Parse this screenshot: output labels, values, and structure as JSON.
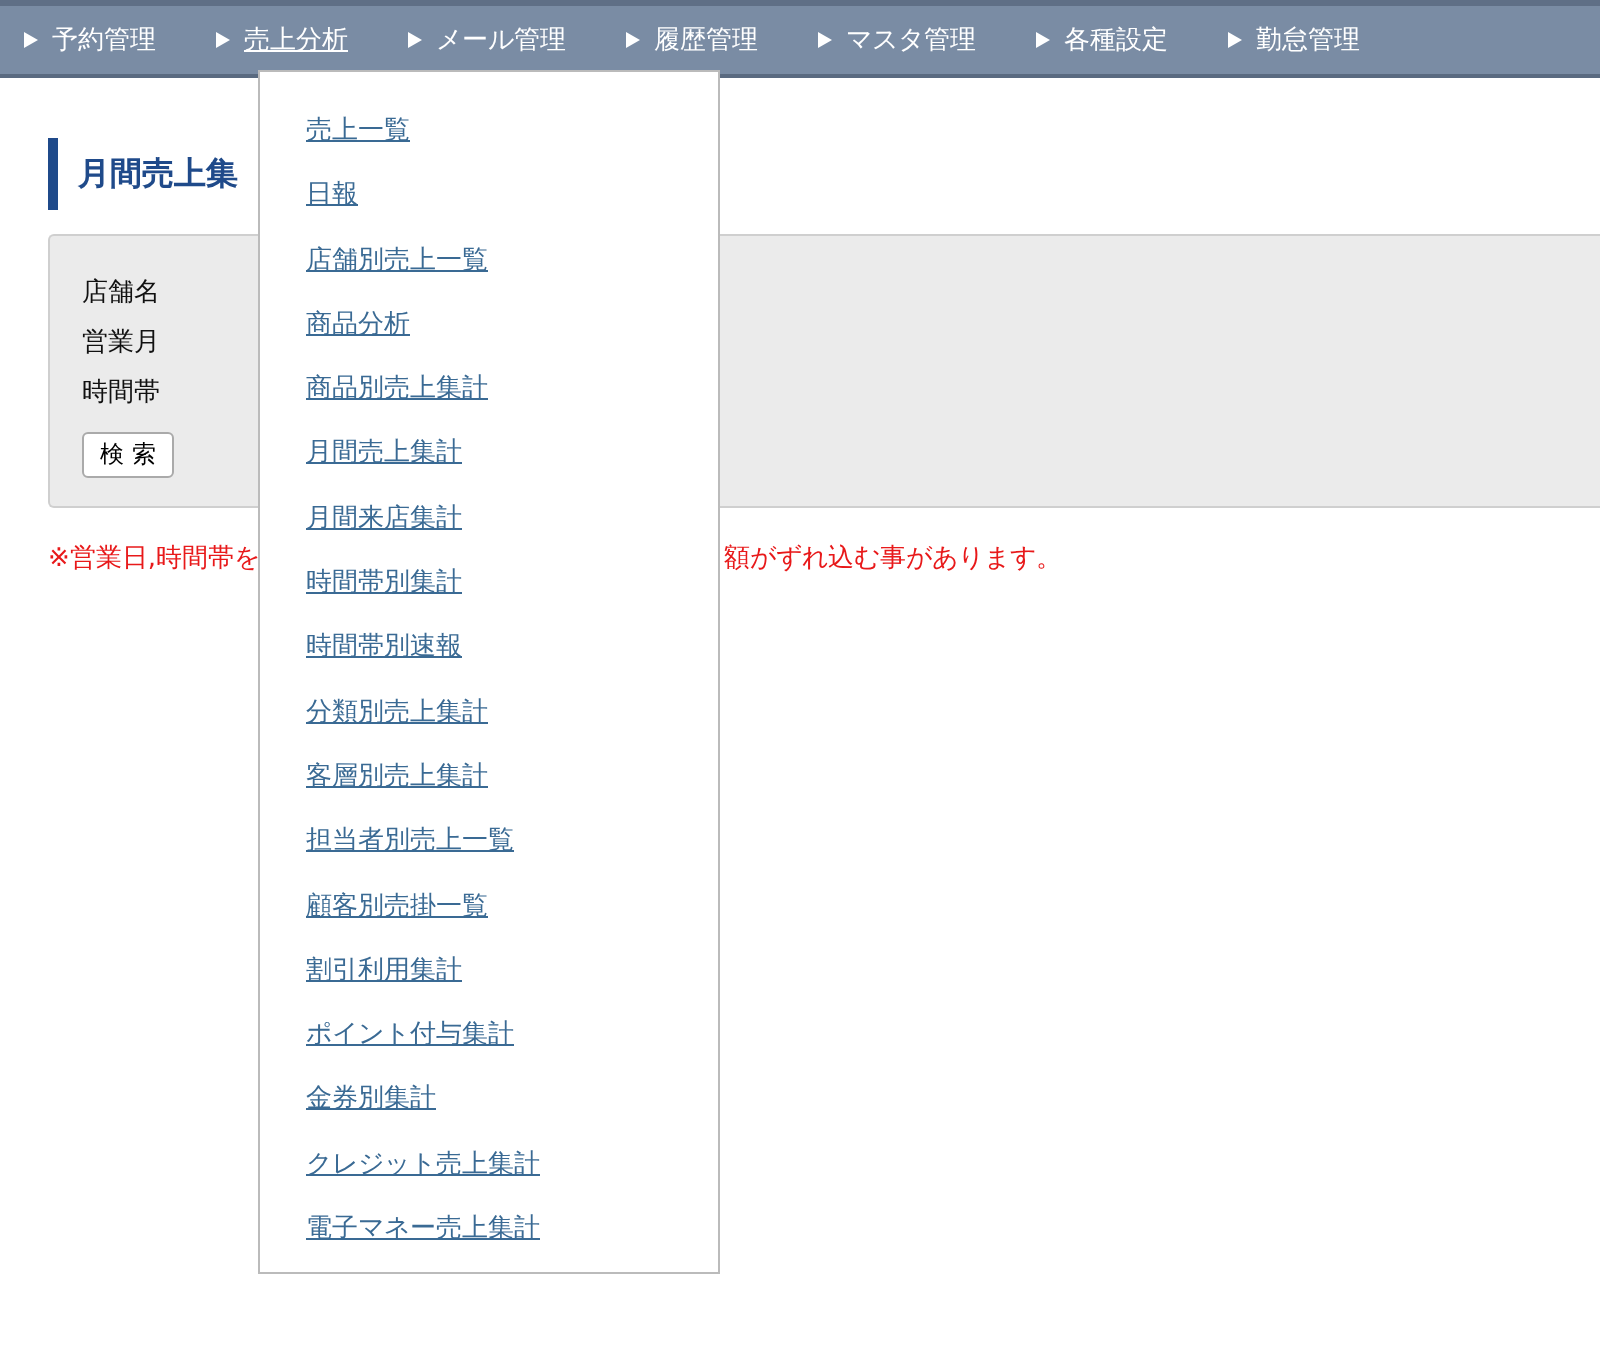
{
  "nav": [
    {
      "label": "予約管理",
      "selected": false
    },
    {
      "label": "売上分析",
      "selected": true
    },
    {
      "label": "メール管理",
      "selected": false
    },
    {
      "label": "履歴管理",
      "selected": false
    },
    {
      "label": "マスタ管理",
      "selected": false
    },
    {
      "label": "各種設定",
      "selected": false
    },
    {
      "label": "勤怠管理",
      "selected": false
    }
  ],
  "dropdown": [
    "売上一覧",
    "日報",
    "店舗別売上一覧",
    "商品分析",
    "商品別売上集計",
    "月間売上集計",
    "月間来店集計",
    "時間帯別集計",
    "時間帯別速報",
    "分類別売上集計",
    "客層別売上集計",
    "担当者別売上一覧",
    "顧客別売掛一覧",
    "割引利用集計",
    "ポイント付与集計",
    "金券別集計",
    "クレジット売上集計",
    "電子マネー売上集計"
  ],
  "page_title": "月間売上集",
  "form": {
    "labels": [
      "店舗名",
      "営業月",
      "時間帯"
    ],
    "search_button": "検 索"
  },
  "note": {
    "left": "※営業日,時間帯を",
    "right": "額がずれ込む事があります。"
  }
}
